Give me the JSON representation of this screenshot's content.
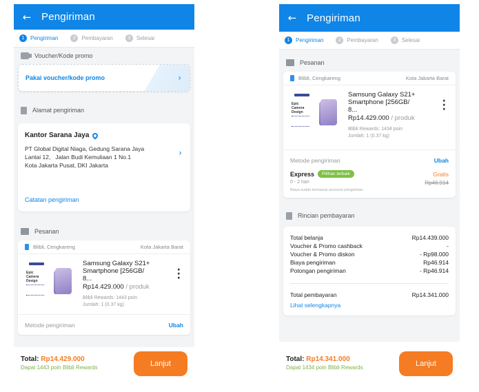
{
  "left": {
    "header": {
      "title": "Pengiriman",
      "back_icon": "arrow-left-icon"
    },
    "steps": [
      {
        "num": "1",
        "label": "Pengiriman"
      },
      {
        "num": "2",
        "label": "Pembayaran"
      },
      {
        "num": "3",
        "label": "Selesai"
      }
    ],
    "voucher": {
      "section_title": "Voucher/Kode promo",
      "button_label": "Pakai voucher/kode promo"
    },
    "address": {
      "section_title": "Alamat pengiriman",
      "name": "Kantor Sarana Jaya",
      "line1": "PT Global Digital Niaga, Gedung Sarana Jaya",
      "line2": "Lantai 12,   Jalan Budi Kemuliaan 1 No.1",
      "line3": "Kota Jakarta Pusat, DKI Jakarta",
      "note_label": "Catatan pengiriman"
    },
    "order": {
      "section_title": "Pesanan",
      "store": "Blibli, Cengkareng",
      "city": "Kota Jakarta Barat",
      "product_name_1": "Samsung Galaxy S21+",
      "product_name_2": "Smartphone [256GB/ 8...",
      "price": "Rp14.429.000",
      "unit": "/ produk",
      "rewards": "Blibli Rewards: 1443 poin",
      "qty": "Jumlah: 1 (0.37 kg)",
      "image_text": "Epic Camera Design",
      "method_label": "Metode pengiriman",
      "method_edit": "Ubah"
    },
    "footer": {
      "total_label": "Total: ",
      "total_amount": "Rp14.429.000",
      "reward_text": "Dapat 1443 poin Blibli Rewards",
      "next_label": "Lanjut"
    }
  },
  "right": {
    "header": {
      "title": "Pengiriman",
      "back_icon": "arrow-left-icon"
    },
    "steps": [
      {
        "num": "1",
        "label": "Pengiriman"
      },
      {
        "num": "2",
        "label": "Pembayaran"
      },
      {
        "num": "3",
        "label": "Selesai"
      }
    ],
    "order": {
      "section_title": "Pesanan",
      "store": "Blibli, Cengkareng",
      "city": "Kota Jakarta Barat",
      "product_name_1": "Samsung Galaxy S21+",
      "product_name_2": "Smartphone [256GB/ 8...",
      "price": "Rp14.429.000",
      "unit": "/ produk",
      "rewards": "Blibli Rewards: 1434 poin",
      "qty": "Jumlah: 1 (0.37 kg)",
      "image_text": "Epic Camera Design"
    },
    "shipping": {
      "label": "Metode pengiriman",
      "edit": "Ubah",
      "type": "Express",
      "badge": "Pilihan terbaik",
      "price_free": "Gratis",
      "eta": "0 - 2 hari",
      "old_price": "Rp46.914",
      "note": "Biaya sudah termasuk asuransi pengiriman."
    },
    "payment": {
      "section_title": "Rincian pembayaran",
      "rows": [
        {
          "label": "Total belanja",
          "value": "Rp14.439.000"
        },
        {
          "label": "Voucher & Promo cashback",
          "value": "-"
        },
        {
          "label": "Voucher & Promo diskon",
          "value": "- Rp98.000"
        },
        {
          "label": "Biaya pengiriman",
          "value": "Rp46.914"
        },
        {
          "label": "Potongan pengiriman",
          "value": "- Rp46.914"
        }
      ],
      "total_label": "Total pembayaran",
      "total_value": "Rp14.341.000",
      "details_link": "Lihat selengkapnya"
    },
    "footer": {
      "total_label": "Total: ",
      "total_amount": "Rp14.341.000",
      "reward_text": "Dapat 1434 poin Blibli Rewards",
      "next_label": "Lanjut"
    }
  },
  "colors": {
    "primary": "#0e85e7",
    "accent": "#f57c23",
    "reward_green": "#7cb342",
    "badge_green": "#7cc142"
  }
}
